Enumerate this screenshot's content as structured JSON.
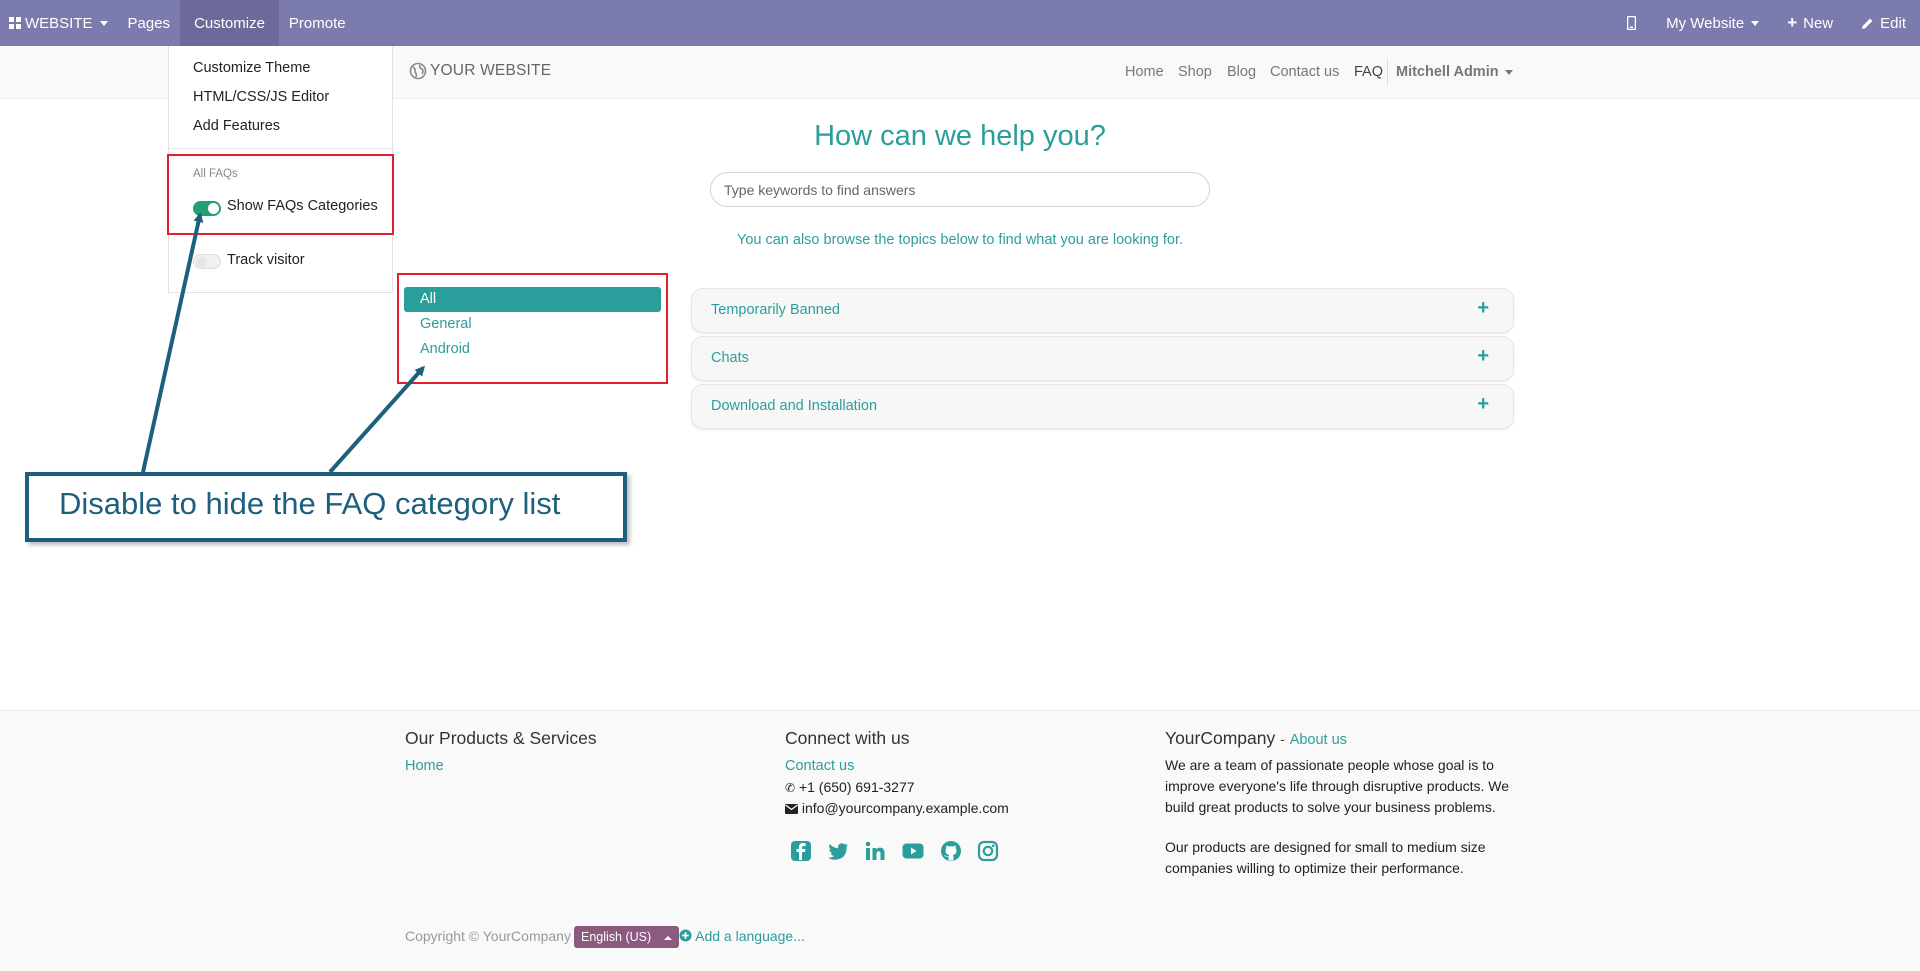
{
  "topbar": {
    "app_menu": "WEBSITE",
    "pages": "Pages",
    "customize": "Customize",
    "promote": "Promote",
    "website_selector": "My Website",
    "new": "New",
    "edit": "Edit"
  },
  "customize_menu": {
    "customize_theme": "Customize Theme",
    "editor": "HTML/CSS/JS Editor",
    "add_features": "Add Features",
    "section_header": "All FAQs",
    "show_categories": "Show FAQs Categories",
    "show_categories_enabled": true,
    "track_visitor": "Track visitor",
    "track_visitor_enabled": false
  },
  "site_header": {
    "logo": "YOUR WEBSITE",
    "nav": [
      "Home",
      "Shop",
      "Blog",
      "Contact us",
      "FAQ"
    ],
    "active_nav": "FAQ",
    "user": "Mitchell Admin"
  },
  "faq": {
    "title": "How can we help you?",
    "search_placeholder": "Type keywords to find answers",
    "subtitle": "You can also browse the topics below to find what you are looking for.",
    "categories": [
      "All",
      "General",
      "Android"
    ],
    "active_category": "All",
    "items": [
      "Temporarily Banned",
      "Chats",
      "Download and Installation"
    ]
  },
  "annotation": {
    "callout": "Disable to hide the FAQ category list",
    "box_color": "#e0212d",
    "arrow_color": "#1d5f7c"
  },
  "footer": {
    "col1_title": "Our Products & Services",
    "col1_link": "Home",
    "col2_title": "Connect with us",
    "contact_link": "Contact us",
    "phone": "+1 (650) 691-3277",
    "email": "info@yourcompany.example.com",
    "social": [
      "facebook-icon",
      "twitter-icon",
      "linkedin-icon",
      "youtube-icon",
      "github-icon",
      "instagram-icon"
    ],
    "col3_title": "YourCompany",
    "col3_sep": "-",
    "about_link": "About us",
    "about_para1": "We are a team of passionate people whose goal is to improve everyone's life through disruptive products. We build great products to solve your business problems.",
    "about_para2": "Our products are designed for small to medium size companies willing to optimize their performance.",
    "copyright": "Copyright © YourCompany",
    "language": "English (US)",
    "add_language": "Add a language..."
  },
  "colors": {
    "topbar": "#7c7bad",
    "accent": "#2b9e9b",
    "toggle_on": "#21a070",
    "lang_button": "#8b5a7e"
  }
}
